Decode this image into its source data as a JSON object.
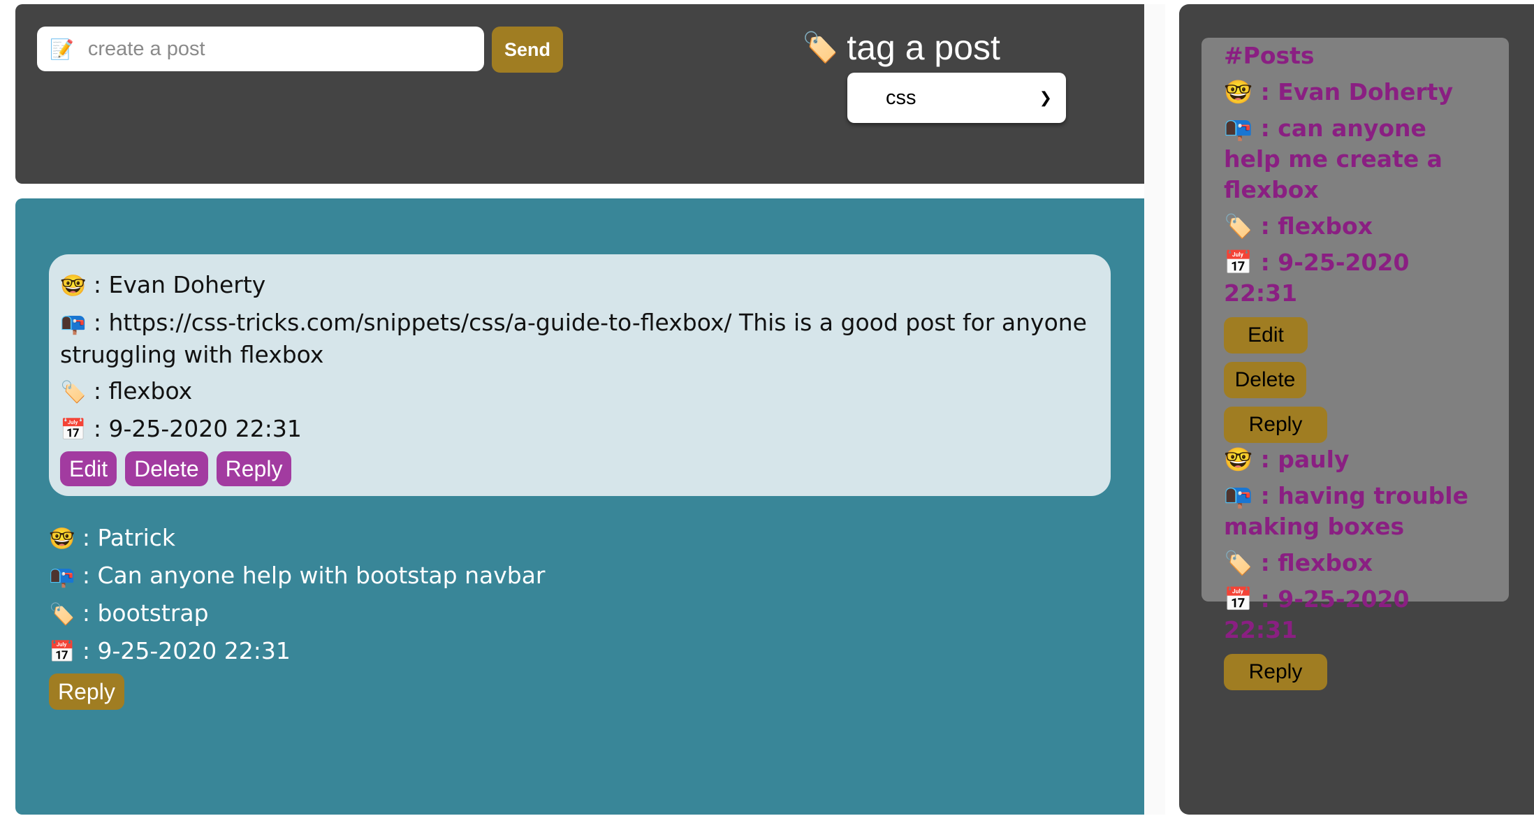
{
  "composer": {
    "input_emoji": "📝",
    "input_placeholder": "create a post",
    "send_label": "Send"
  },
  "tagger": {
    "emoji": "🏷️",
    "title": "tag a post",
    "selected": "css"
  },
  "main": {
    "posts": [
      {
        "author": ": Evan Doherty",
        "message": ": https://css-tricks.com/snippets/css/a-guide-to-flexbox/ This is a good post for anyone struggling with flexbox",
        "tag": ": flexbox",
        "date": ": 9-25-2020 22:31",
        "actions": [
          "Edit",
          "Delete",
          "Reply"
        ]
      },
      {
        "author": ": Patrick",
        "message": ": Can anyone help with bootstap navbar",
        "tag": ": bootstrap",
        "date": ": 9-25-2020 22:31",
        "actions": [
          "Reply"
        ]
      }
    ]
  },
  "sidebar": {
    "heading": "#Posts",
    "posts": [
      {
        "author": ": Evan Doherty",
        "message": ": can anyone help me create a flexbox",
        "tag": ": flexbox",
        "date": ": 9-25-2020 22:31",
        "actions": [
          "Edit",
          "Delete",
          "Reply"
        ]
      },
      {
        "author": ": pauly",
        "message": ": having trouble making boxes",
        "tag": ": flexbox",
        "date": ": 9-25-2020 22:31",
        "actions": [
          "Reply"
        ]
      }
    ]
  },
  "icons": {
    "user": "🤓",
    "message": "📭",
    "tag": "🏷️",
    "date": "📅"
  },
  "colors": {
    "dark_panel": "#444444",
    "teal_panel": "#398698",
    "card_bg": "#d6e5ea",
    "gold_button": "#a07d22",
    "purple_button": "#a23ba0",
    "sidebar_text": "#8a1f82",
    "sidebar_box": "#808080"
  }
}
